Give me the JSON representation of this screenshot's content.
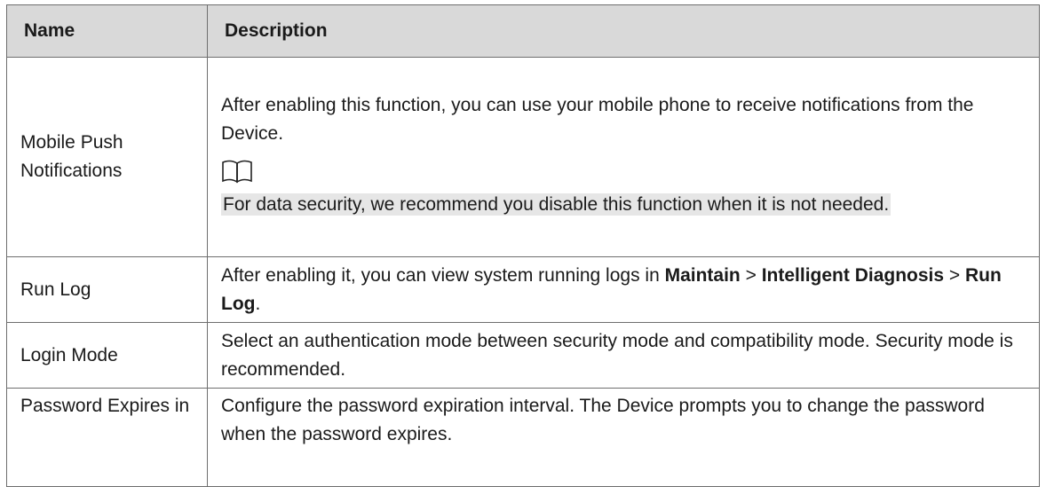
{
  "table": {
    "headers": {
      "name": "Name",
      "description": "Description"
    },
    "rows": {
      "mobile_push": {
        "name": "Mobile Push Notifications",
        "description": "After enabling this function, you can use your mobile phone to receive notifications from the Device.",
        "note_icon": "book-icon",
        "note": "For data security, we recommend you disable this function when it is not needed."
      },
      "run_log": {
        "name": "Run Log",
        "desc_prefix": "After enabling it, you can view system running logs in ",
        "path_1": "Maintain",
        "sep_1": " > ",
        "path_2": "Intelligent Diagnosis",
        "sep_2": " > ",
        "path_3": "Run Log",
        "desc_suffix": "."
      },
      "login_mode": {
        "name": "Login Mode",
        "description": "Select an authentication mode between security mode and compatibility mode. Security mode is recommended."
      },
      "password_expires": {
        "name": "Password Expires in",
        "description": "Configure the password expiration interval. The Device prompts you to change the password when the password expires."
      }
    }
  }
}
